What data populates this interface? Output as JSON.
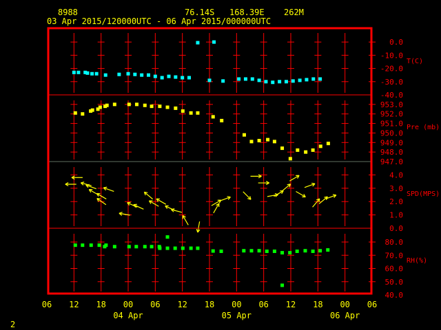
{
  "header": {
    "station": "8988",
    "lat": "76.14S",
    "lon": "168.39E",
    "elev": "262M",
    "period": "03 Apr 2015/120000UTC - 06 Apr 2015/000000UTC"
  },
  "page_number": "2",
  "colors": {
    "frame": "#ff0000",
    "text": "#ffff00",
    "temp": "#00ffff",
    "pressure": "#ffff00",
    "wind": "#ffff00",
    "rh": "#00ff00"
  },
  "chart_data": {
    "type": "scatter",
    "x_ticks": {
      "hours": [
        0,
        6,
        12,
        18,
        24,
        30,
        36,
        42,
        48,
        54,
        60,
        66,
        72
      ],
      "labels": [
        "06",
        "12",
        "18",
        "00",
        "06",
        "12",
        "18",
        "00",
        "06",
        "12",
        "18",
        "00",
        "06"
      ]
    },
    "date_labels": [
      {
        "hours": 18,
        "label": "04 Apr"
      },
      {
        "hours": 42,
        "label": "05 Apr"
      },
      {
        "hours": 66,
        "label": "06 Apr"
      }
    ],
    "xlim": [
      0,
      72
    ],
    "panels": [
      {
        "id": "temp",
        "label": "T(C)",
        "ylim": [
          -40,
          11
        ],
        "ticks": [
          0,
          -10,
          -20,
          -30,
          -40
        ],
        "tick_labels": [
          "0.0",
          "-10.0",
          "-20.0",
          "-30.0",
          "-40.0"
        ],
        "points": [
          [
            6,
            -23
          ],
          [
            7,
            -23
          ],
          [
            8.5,
            -23
          ],
          [
            9,
            -23.5
          ],
          [
            10,
            -24
          ],
          [
            11,
            -24
          ],
          [
            13,
            -25
          ],
          [
            16,
            -24.5
          ],
          [
            18,
            -24
          ],
          [
            19.5,
            -24.5
          ],
          [
            21,
            -25
          ],
          [
            22.5,
            -25
          ],
          [
            24,
            -26
          ],
          [
            25.5,
            -27
          ],
          [
            27,
            -26
          ],
          [
            28.5,
            -26.5
          ],
          [
            30,
            -27
          ],
          [
            31.5,
            -27
          ],
          [
            33.4,
            -0.5
          ],
          [
            36,
            -29
          ],
          [
            37,
            0
          ],
          [
            39,
            -29.5
          ],
          [
            42.5,
            -28
          ],
          [
            44,
            -28
          ],
          [
            45.5,
            -28
          ],
          [
            47,
            -29
          ],
          [
            48.5,
            -30
          ],
          [
            50,
            -30.5
          ],
          [
            51.5,
            -30
          ],
          [
            53,
            -30
          ],
          [
            54.5,
            -29.5
          ],
          [
            56,
            -29
          ],
          [
            57.5,
            -28.5
          ],
          [
            59,
            -28
          ],
          [
            60.5,
            -28
          ]
        ]
      },
      {
        "id": "pressure",
        "label": "Pre (mb)",
        "ylim": [
          947,
          954
        ],
        "ticks": [
          953,
          952,
          951,
          950,
          949,
          948,
          947
        ],
        "tick_labels": [
          "953.0",
          "952.0",
          "951.0",
          "950.0",
          "949.0",
          "948.0",
          "947.0"
        ],
        "points": [
          [
            6.3,
            952.1
          ],
          [
            7.9,
            952.0
          ],
          [
            9.7,
            952.3
          ],
          [
            10.1,
            952.4
          ],
          [
            11.3,
            952.5
          ],
          [
            11.8,
            952.7
          ],
          [
            12.9,
            952.8
          ],
          [
            13.3,
            952.9
          ],
          [
            15,
            953.0
          ],
          [
            18.2,
            953.0
          ],
          [
            19.9,
            953.0
          ],
          [
            21.7,
            952.9
          ],
          [
            23.2,
            952.8
          ],
          [
            25,
            952.8
          ],
          [
            26.7,
            952.7
          ],
          [
            28.5,
            952.6
          ],
          [
            30.1,
            952.3
          ],
          [
            31.9,
            952.1
          ],
          [
            33.4,
            952.1
          ],
          [
            36.8,
            951.7
          ],
          [
            38.7,
            951.3
          ],
          [
            43.7,
            949.8
          ],
          [
            45.3,
            949.1
          ],
          [
            47,
            949.2
          ],
          [
            48.9,
            949.3
          ],
          [
            50.4,
            949.1
          ],
          [
            52.1,
            948.4
          ],
          [
            53.9,
            947.3
          ],
          [
            55.5,
            948.2
          ],
          [
            57.3,
            948.0
          ],
          [
            58.9,
            948.2
          ],
          [
            60.6,
            948.6
          ],
          [
            62.3,
            948.9
          ]
        ]
      },
      {
        "id": "wind",
        "label": "SPD(MPS)",
        "ylim": [
          0,
          5
        ],
        "ticks": [
          4,
          3,
          2,
          1,
          0
        ],
        "tick_labels": [
          "4.0",
          "3.0",
          "2.0",
          "1.0",
          "0.0"
        ],
        "points": [
          [
            5.3,
            3.3,
            180
          ],
          [
            6.7,
            3.8,
            180
          ],
          [
            8.7,
            3.3,
            165
          ],
          [
            9.8,
            3.1,
            160
          ],
          [
            10.4,
            2.7,
            150
          ],
          [
            12.1,
            2.4,
            150
          ],
          [
            12.1,
            2.0,
            145
          ],
          [
            13.7,
            2.9,
            160
          ],
          [
            17.2,
            1.05,
            170
          ],
          [
            18.9,
            1.75,
            155
          ],
          [
            20.3,
            1.6,
            155
          ],
          [
            22.5,
            2.45,
            140
          ],
          [
            23.7,
            1.85,
            150
          ],
          [
            25.3,
            2.0,
            150
          ],
          [
            27.3,
            1.5,
            155
          ],
          [
            28.7,
            1.3,
            165
          ],
          [
            30.7,
            0.6,
            120
          ],
          [
            33.6,
            0.1,
            -100
          ],
          [
            37.5,
            1.9,
            30
          ],
          [
            37.5,
            1.5,
            60
          ],
          [
            39.5,
            2.2,
            20
          ],
          [
            44.3,
            2.45,
            -45
          ],
          [
            46.3,
            3.9,
            0
          ],
          [
            48,
            3.4,
            0
          ],
          [
            50,
            2.45,
            10
          ],
          [
            51.3,
            2.6,
            30
          ],
          [
            53,
            3.05,
            40
          ],
          [
            54.8,
            3.75,
            30
          ],
          [
            56.2,
            2.55,
            -30
          ],
          [
            58.2,
            3.2,
            20
          ],
          [
            59.6,
            1.9,
            50
          ],
          [
            61.2,
            2.1,
            40
          ],
          [
            62.9,
            2.35,
            20
          ]
        ]
      },
      {
        "id": "rh",
        "label": "RH(%)",
        "ylim": [
          40,
          90.4
        ],
        "ticks": [
          80,
          70,
          60,
          50,
          40
        ],
        "tick_labels": [
          "80.0",
          "70.0",
          "60.0",
          "50.0",
          "40.0"
        ],
        "points": [
          [
            6.3,
            77.6
          ],
          [
            7.9,
            77.6
          ],
          [
            9.8,
            77.6
          ],
          [
            11.6,
            77.6
          ],
          [
            12.8,
            76.5
          ],
          [
            13.1,
            77.6
          ],
          [
            15,
            76.5
          ],
          [
            18.2,
            76.5
          ],
          [
            19.8,
            76.5
          ],
          [
            21.7,
            76.5
          ],
          [
            23.2,
            76.5
          ],
          [
            24.9,
            76.5
          ],
          [
            25,
            75.3
          ],
          [
            26.7,
            83.8
          ],
          [
            26.7,
            75.3
          ],
          [
            28.4,
            75.3
          ],
          [
            30.1,
            75.3
          ],
          [
            31.9,
            75.3
          ],
          [
            33.4,
            75.3
          ],
          [
            36.8,
            73.2
          ],
          [
            38.6,
            73.0
          ],
          [
            43.6,
            73.4
          ],
          [
            45.3,
            73.4
          ],
          [
            47,
            73.4
          ],
          [
            48.7,
            73.0
          ],
          [
            50.4,
            73.0
          ],
          [
            52.1,
            71.9
          ],
          [
            52.1,
            47.3
          ],
          [
            53.8,
            71.9
          ],
          [
            55.4,
            73.0
          ],
          [
            57.2,
            73.4
          ],
          [
            58.9,
            73.0
          ],
          [
            60.5,
            73.4
          ],
          [
            62.2,
            74.0
          ]
        ]
      }
    ]
  }
}
